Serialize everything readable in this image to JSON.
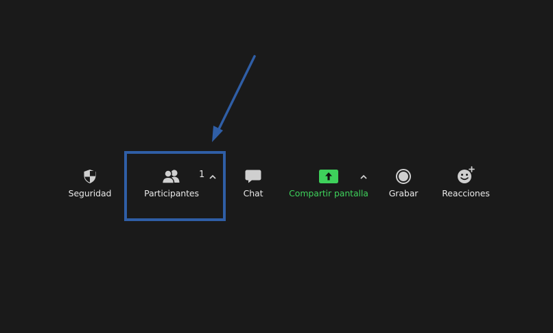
{
  "toolbar": {
    "security_label": "Seguridad",
    "participants_label": "Participantes",
    "participants_count": "1",
    "chat_label": "Chat",
    "share_screen_label": "Compartir pantalla",
    "record_label": "Grabar",
    "reactions_label": "Reacciones"
  },
  "colors": {
    "background": "#1a1a1a",
    "text": "#e8e8e8",
    "icon": "#cfcfcf",
    "share_green": "#3ed15b",
    "highlight_blue": "#2f5ea6"
  },
  "icons": {
    "security": "shield-icon",
    "participants": "participants-icon",
    "chat": "chat-bubble-icon",
    "share_screen": "share-screen-icon",
    "record": "record-icon",
    "reactions": "reactions-icon",
    "options": "chevron-up-icon"
  }
}
